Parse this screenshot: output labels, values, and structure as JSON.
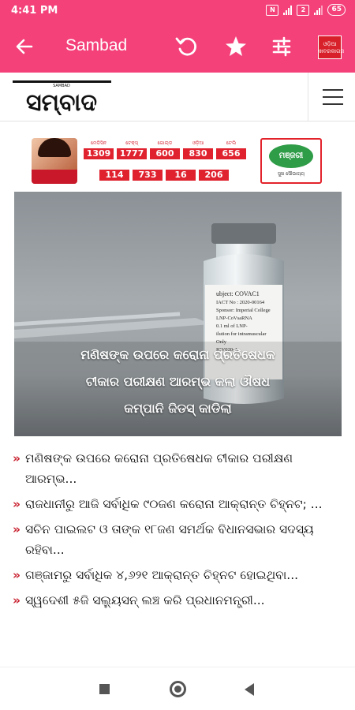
{
  "status_bar": {
    "time": "4:41 PM",
    "battery": "65",
    "icons": [
      "nfc-icon",
      "signal-4g-icon",
      "signal-icon",
      "battery-icon"
    ]
  },
  "app_bar": {
    "title": "Sambad",
    "icons": [
      "back-arrow-icon",
      "refresh-icon",
      "star-icon",
      "settings-sliders-icon",
      "sambad-thumbnail-icon"
    ],
    "thumb_text": "ଓଡ଼ିଆ ଖବରକାଗଜ"
  },
  "site": {
    "logo_text": "ସମ୍ବାଦ",
    "logo_small": "SAMBAD"
  },
  "ad": {
    "scores_row1": [
      {
        "label": "ମେଡିସିନ",
        "value": "1309"
      },
      {
        "label": "ଟେକ୍ସ୍",
        "value": "1777"
      },
      {
        "label": "ଗୋଲ୍ଡ",
        "value": "600"
      },
      {
        "label": "ଓଡ଼ିଆ",
        "value": "830"
      },
      {
        "label": "ଟେଲି",
        "value": "656"
      }
    ],
    "scores_row2": [
      {
        "label": "",
        "value": "114"
      },
      {
        "label": "",
        "value": "733"
      },
      {
        "label": "",
        "value": "16"
      },
      {
        "label": "",
        "value": "206"
      }
    ],
    "brand": "ମଞ୍ଜରୀ",
    "brand_tag": "ସୁଖ ସୌଭାଗ୍ୟ"
  },
  "hero": {
    "vial_label": [
      "ubject: COVAC1",
      "IACT No : 2020-00164",
      "Sponsor: Imperial College",
      "LNP-CoVsaRNA",
      "0.1 ml of LNP-",
      "ilution for intramuscular",
      "Only",
      "ICV020-A"
    ],
    "caption_lines": [
      "ମଣିଷଙ୍କ ଉପରେ କରୋନା ପ୍ରତିଷେଧକ",
      "ଟୀକାର ପରୀକ୍ଷଣ ଆରମ୍ଭ କଲା ଔଷଧ",
      "କମ୍ପାନି ଜିଡସ୍ କାଡିଲା"
    ]
  },
  "news": [
    {
      "arrow": "»",
      "text": "ମଣିଷଙ୍କ ଉପରେ କରୋନା ପ୍ରତିଷେଧକ ଟୀକାର ପରୀକ୍ଷଣ ଆରମ୍ଭ..."
    },
    {
      "arrow": "»",
      "text": "ରାଜଧାନୀରୁ ଆଜି ସର୍ବାଧିକ ୯୦ଜଣ କରୋନା ଆକ୍ରାନ୍ତ ଚିହ୍ନଟ; ..."
    },
    {
      "arrow": "»",
      "text": "ସଚିନ ପାଇଲଟ ଓ ତାଙ୍କ ୧୮ଜଣ ସମର୍ଥକ ବିଧାନସଭାର ସଦସ୍ୟ ରହିବା..."
    },
    {
      "arrow": "»",
      "text": "ଗଞ୍ଜାମରୁ ସର୍ବାଧିକ ୪,୬୨୧ ଆକ୍ରାନ୍ତ ଚିହ୍ନଟ ହୋଇଥିବା..."
    },
    {
      "arrow": "»",
      "text": "ସ୍ୱଦେଶୀ ୫ଜି ସଲ୍ୟୁସନ୍ ଲଞ୍ଚ କରି ପ୍ରଧାନମନ୍ତ୍ରୀ..."
    }
  ],
  "nav_bar": {
    "icons": [
      "recents-square-icon",
      "home-circle-icon",
      "back-triangle-icon"
    ]
  },
  "colors": {
    "accent": "#f4417a",
    "ad_red": "#e0222f",
    "news_arrow": "#c8202e"
  }
}
